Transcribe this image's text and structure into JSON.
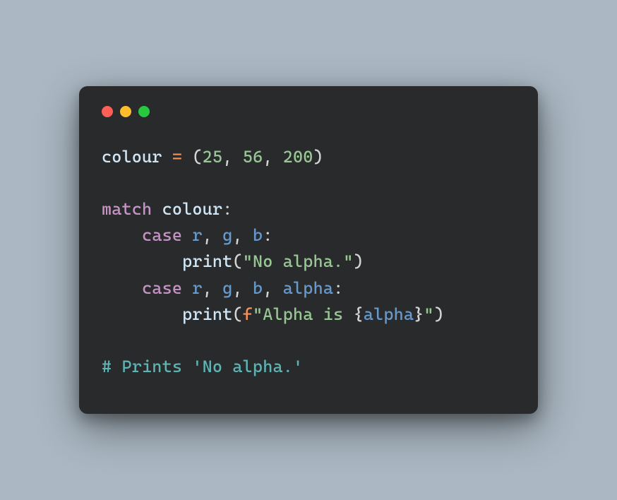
{
  "code": {
    "line1": {
      "var": "colour",
      "op": "=",
      "open": "(",
      "n1": "25",
      "c1": ",",
      "n2": "56",
      "c2": ",",
      "n3": "200",
      "close": ")"
    },
    "line3": {
      "kw": "match",
      "name": "colour",
      "colon": ":"
    },
    "line4": {
      "kw": "case",
      "p1": "r",
      "c1": ",",
      "p2": "g",
      "c2": ",",
      "p3": "b",
      "colon": ":"
    },
    "line5": {
      "fn": "print",
      "open": "(",
      "str": "\"No alpha.\"",
      "close": ")"
    },
    "line6": {
      "kw": "case",
      "p1": "r",
      "c1": ",",
      "p2": "g",
      "c2": ",",
      "p3": "b",
      "c3": ",",
      "p4": "alpha",
      "colon": ":"
    },
    "line7": {
      "fn": "print",
      "open": "(",
      "fpre": "f",
      "s1": "\"Alpha is ",
      "bo": "{",
      "interp": "alpha",
      "bc": "}",
      "s2": "\"",
      "close": ")"
    },
    "line9": {
      "comment": "# Prints 'No alpha.'"
    }
  }
}
